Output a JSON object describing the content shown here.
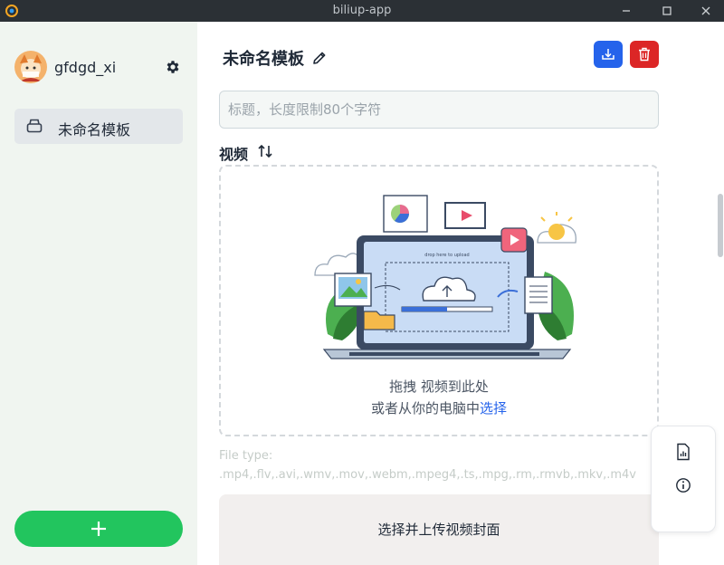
{
  "window": {
    "title": "biliup-app"
  },
  "sidebar": {
    "username": "gfdgd_xi",
    "items": [
      {
        "label": "未命名模板",
        "icon": "box-icon"
      }
    ],
    "add_label": "+"
  },
  "main": {
    "title": "未命名模板",
    "title_input_placeholder": "标题，长度限制80个字符",
    "video_label": "视频",
    "drop_prefix": "拖拽 视频到此处",
    "drop_line2": "或者从你的电脑中",
    "drop_link": "选择",
    "illustration_caption": "drop here to upload",
    "file_type_label": "File type:",
    "file_types": ".mp4,.flv,.avi,.wmv,.mov,.webm,.mpeg4,.ts,.mpg,.rm,.rmvb,.mkv,.m4v",
    "cover_label": "选择并上传视频封面"
  },
  "colors": {
    "accent": "#2563eb",
    "danger": "#dc2626",
    "add": "#22c55e",
    "sidebar_bg": "#f0f5f0"
  }
}
